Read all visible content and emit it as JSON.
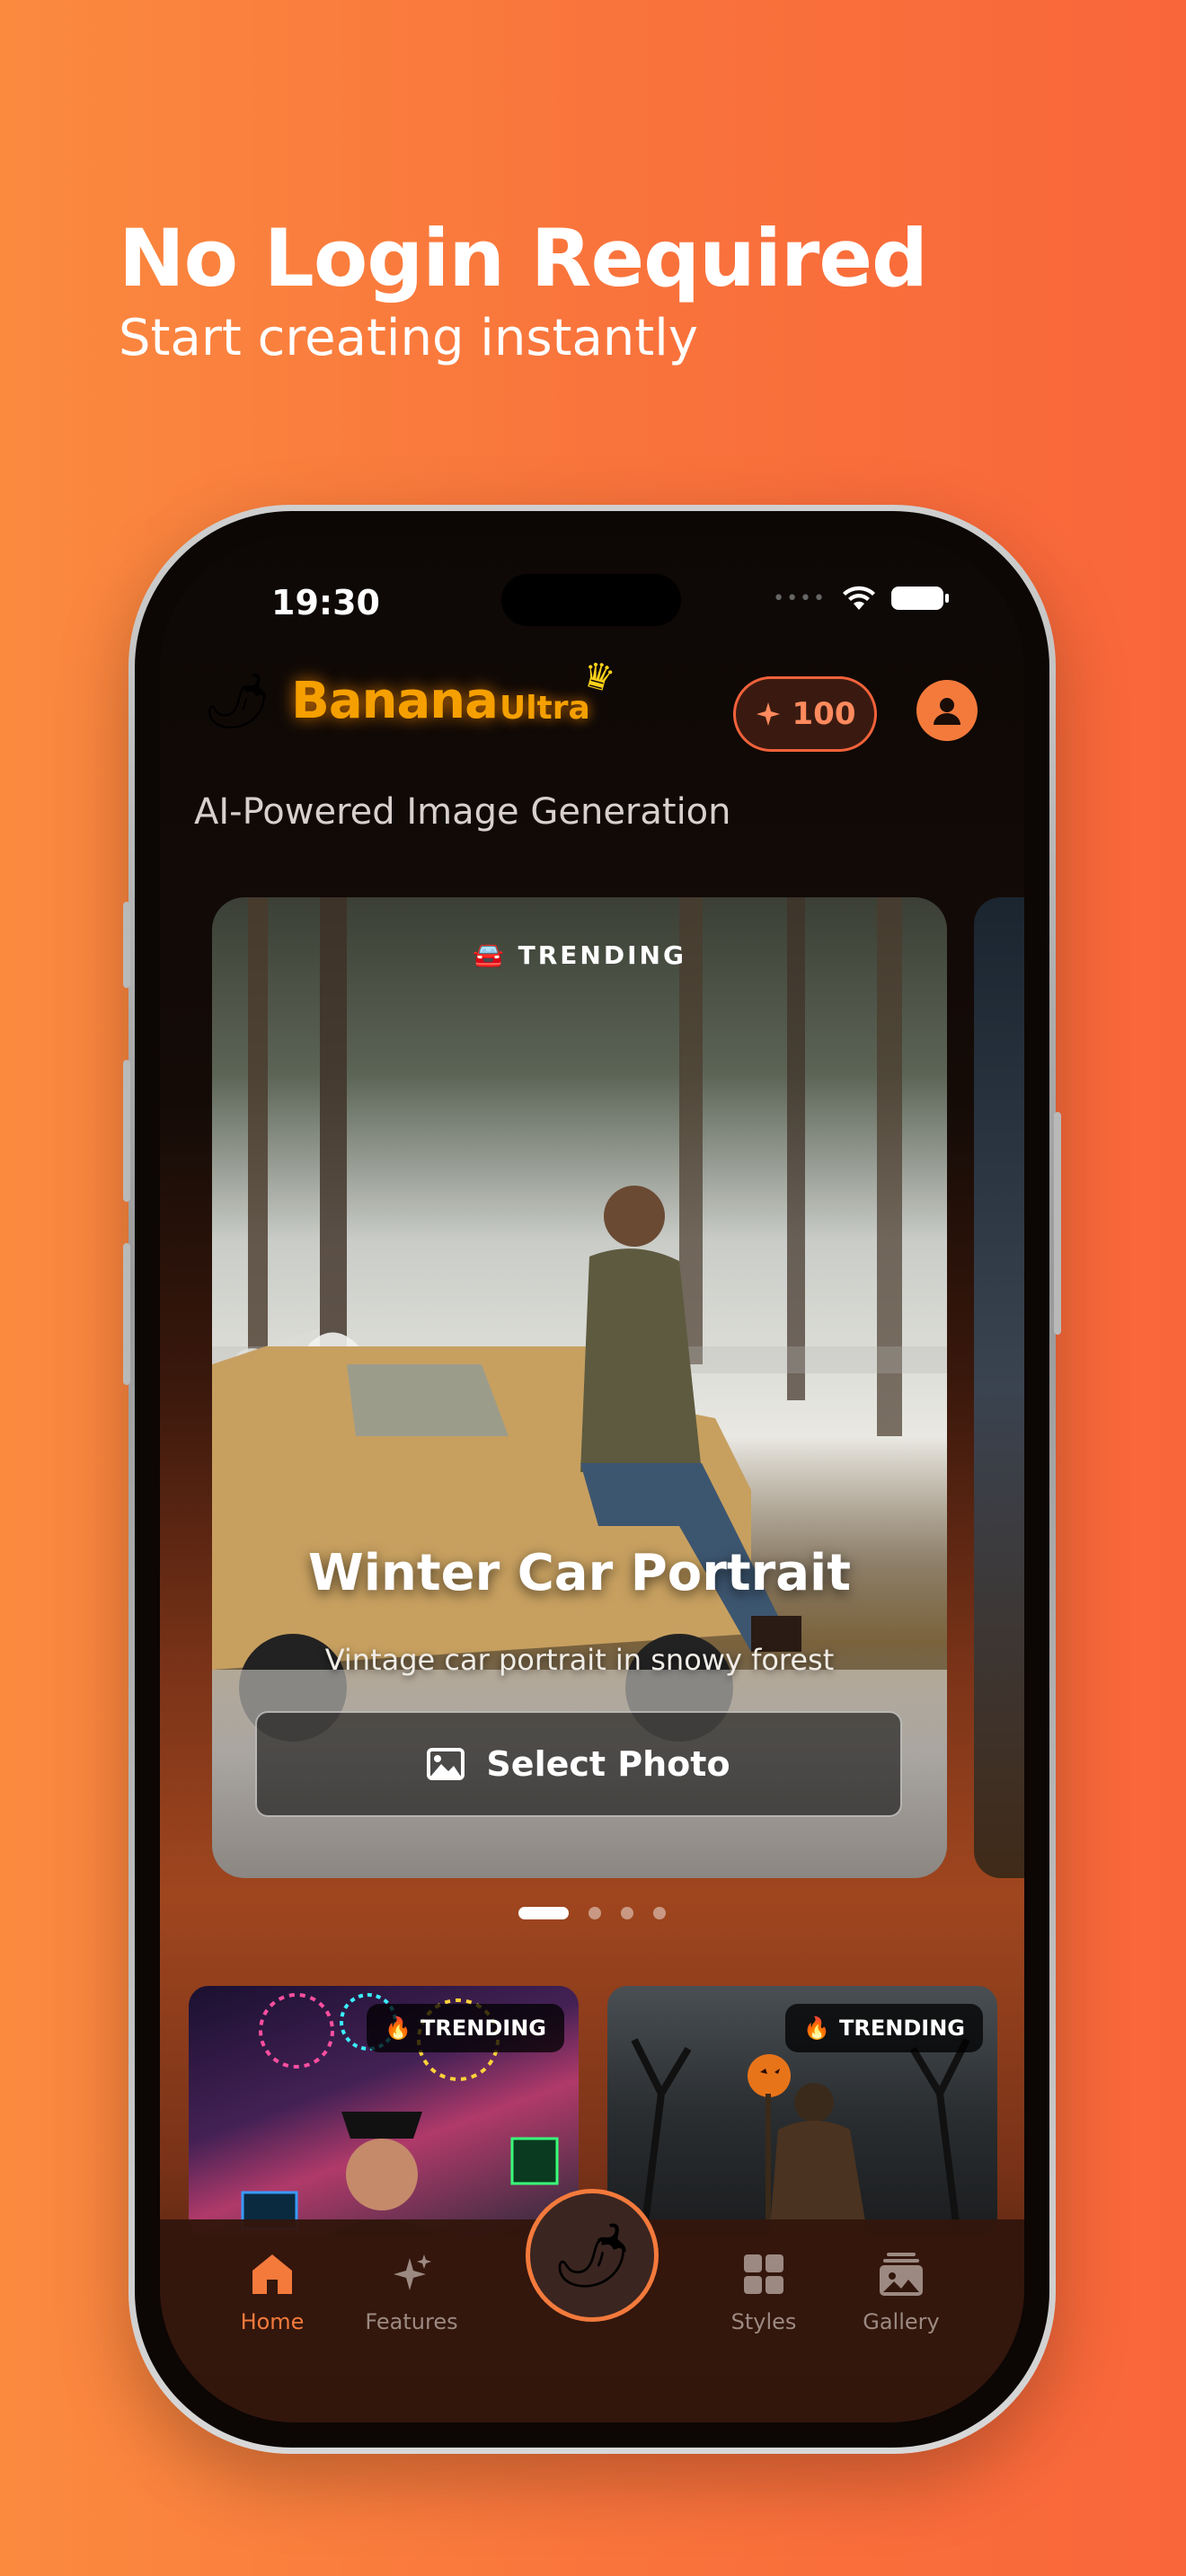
{
  "promo": {
    "headline": "No Login Required",
    "subline": "Start creating instantly"
  },
  "status_bar": {
    "time": "19:30"
  },
  "header": {
    "logo_main": "Banana",
    "logo_suffix": "Ultra",
    "credits": "100",
    "tagline": "AI-Powered Image Generation"
  },
  "featured": {
    "badge": "🚘 TRENDING",
    "title": "Winter Car Portrait",
    "description": "Vintage car portrait in snowy forest",
    "button_label": "Select Photo",
    "page_count": 4,
    "active_page": 1
  },
  "grid": [
    {
      "badge": "TRENDING",
      "badge_icon": "flame-icon"
    },
    {
      "badge": "TRENDING",
      "badge_icon": "flame-icon"
    }
  ],
  "tabbar": {
    "home": "Home",
    "features": "Features",
    "styles": "Styles",
    "gallery": "Gallery"
  },
  "colors": {
    "accent": "#f47a3c",
    "logo": "#f5a000",
    "background": "#f9743c"
  }
}
